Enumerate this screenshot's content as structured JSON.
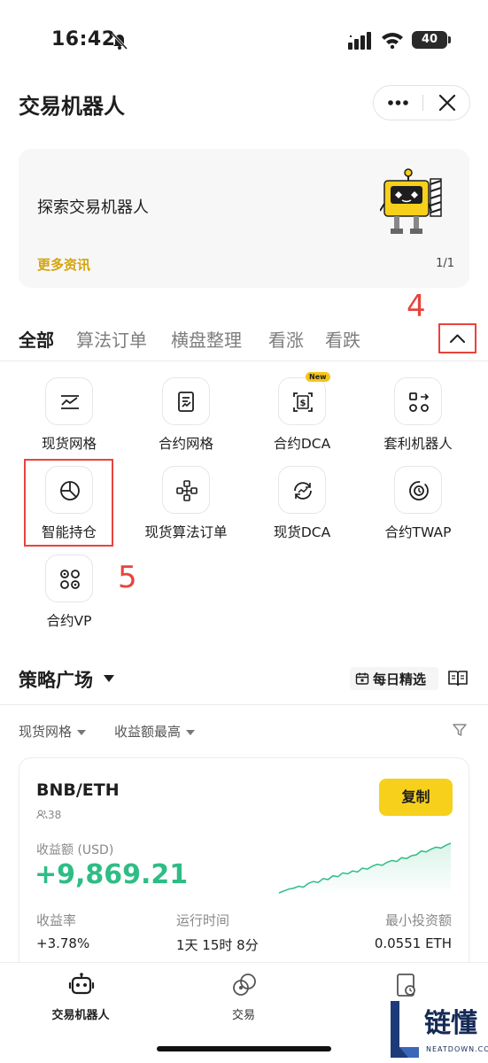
{
  "status_bar": {
    "time": "16:42",
    "battery": "40"
  },
  "header": {
    "title": "交易机器人"
  },
  "banner": {
    "title": "探索交易机器人",
    "link": "更多资讯",
    "page": "1/1"
  },
  "annotations": {
    "step4": "4",
    "step5": "5"
  },
  "tabs": [
    {
      "label": "全部",
      "active": true
    },
    {
      "label": "算法订单"
    },
    {
      "label": "横盘整理"
    },
    {
      "label": "看涨"
    },
    {
      "label": "看跌"
    }
  ],
  "tools": [
    {
      "label": "现货网格",
      "icon": "grid-chart-icon"
    },
    {
      "label": "合约网格",
      "icon": "contract-doc-icon"
    },
    {
      "label": "合约DCA",
      "icon": "dca-icon",
      "badge": "New"
    },
    {
      "label": "套利机器人",
      "icon": "arbitrage-icon"
    },
    {
      "label": "智能持仓",
      "icon": "pie-chart-icon"
    },
    {
      "label": "现货算法订单",
      "icon": "algo-order-icon"
    },
    {
      "label": "现货DCA",
      "icon": "spot-dca-icon"
    },
    {
      "label": "合约TWAP",
      "icon": "twap-icon"
    },
    {
      "label": "合约VP",
      "icon": "vp-icon"
    }
  ],
  "strategy": {
    "title": "策略广场",
    "daily_pick": "每日精选",
    "filters": [
      "现货网格",
      "收益额最高"
    ]
  },
  "card": {
    "pair": "BNB/ETH",
    "followers": "38",
    "copy_label": "复制",
    "profit_label": "收益额 (USD)",
    "profit_value": "+9,869.21",
    "stats": [
      {
        "label": "收益率",
        "value": "+3.78%"
      },
      {
        "label": "运行时间",
        "value": "1天 15时 8分"
      },
      {
        "label": "最小投资额",
        "value": "0.0551 ETH"
      }
    ],
    "spark_values": [
      8,
      10,
      12,
      13,
      15,
      14,
      18,
      20,
      19,
      23,
      22,
      26,
      25,
      29,
      28,
      31,
      30,
      34,
      33,
      36,
      38,
      37,
      40,
      42,
      41,
      45,
      44,
      47,
      48,
      52,
      51,
      54,
      56,
      55,
      58,
      60
    ],
    "accent": "#2ebd85"
  },
  "bottom_nav": [
    {
      "label": "交易机器人",
      "active": true
    },
    {
      "label": "交易"
    },
    {
      "label": ""
    }
  ],
  "watermark": {
    "cn": "链懂",
    "en": "NEATDOWN.COM"
  },
  "colors": {
    "brand_yellow": "#f7d01c",
    "link_gold": "#d4a40b",
    "annotation_red": "#e8433d",
    "profit_green": "#2ebd85"
  }
}
